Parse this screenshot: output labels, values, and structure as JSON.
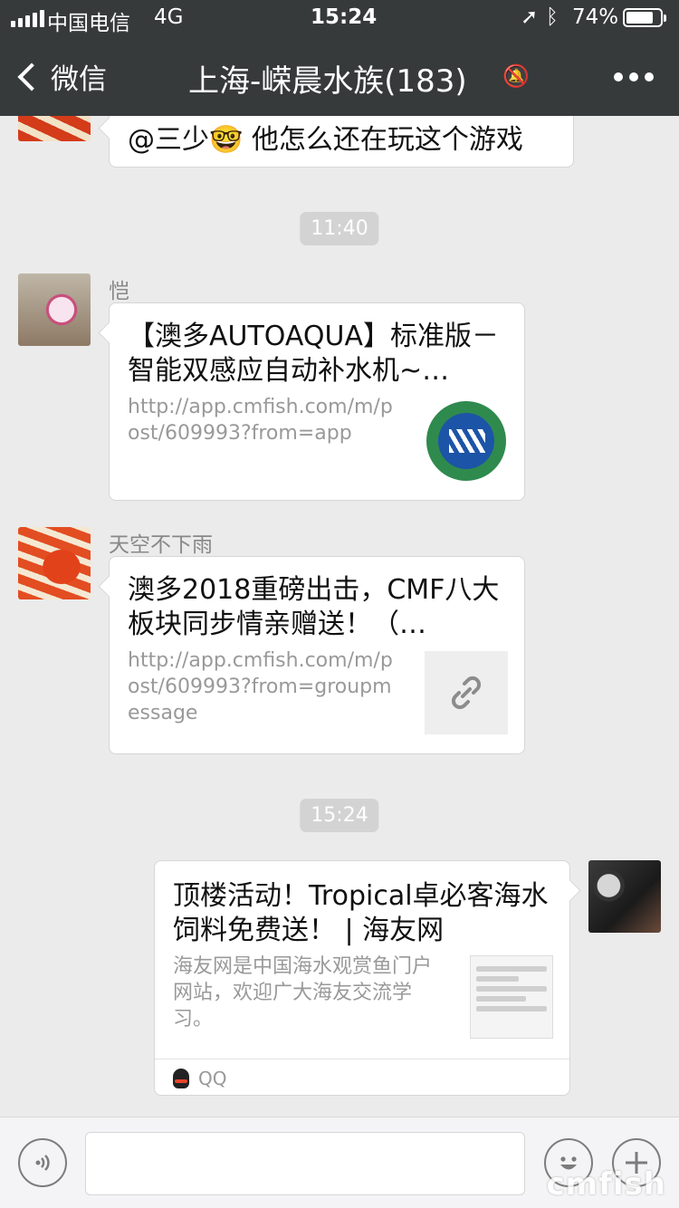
{
  "status_bar": {
    "carrier": "中国电信",
    "network": "4G",
    "time": "15:24",
    "battery": "74%",
    "battery_level": 0.74
  },
  "nav": {
    "back_label": "微信",
    "title": "上海-嵘晨水族(183)"
  },
  "messages": {
    "m0": {
      "text": "@三少🤓 他怎么还在玩这个游戏"
    },
    "t1": "11:40",
    "m1": {
      "sender": "恺",
      "title": "【澳多AUTOAQUA】标准版－智能双感应自动补水机~…",
      "desc": "http://app.cmfish.com/m/post/609993?from=app"
    },
    "m2": {
      "sender": "天空不下雨",
      "title": "澳多2018重磅出击，CMF八大板块同步情亲赠送！（…",
      "desc": "http://app.cmfish.com/m/post/609993?from=groupmessage"
    },
    "t2": "15:24",
    "m3": {
      "title": "顶楼活动！Tropical卓必客海水饲料免费送！ | 海友网",
      "desc": "海友网是中国海水观赏鱼门户网站，欢迎广大海友交流学习。",
      "source": "QQ"
    }
  },
  "watermark": "cmfish"
}
